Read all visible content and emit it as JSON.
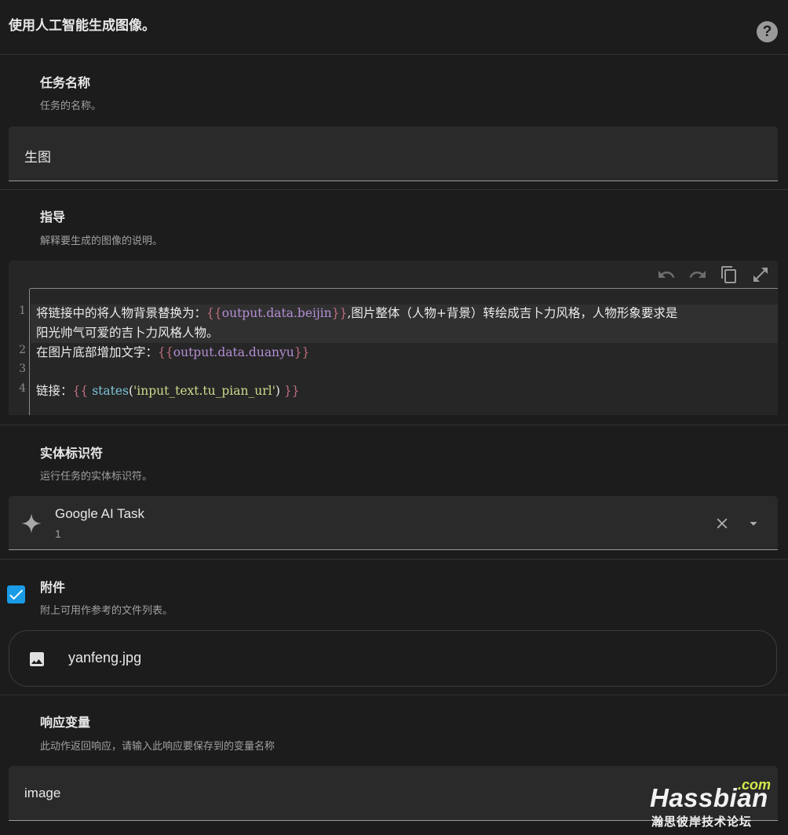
{
  "header": {
    "title": "使用人工智能生成图像。",
    "help_icon": "help-circle-icon"
  },
  "task_name": {
    "label": "任务名称",
    "description": "任务的名称。",
    "value": "生图"
  },
  "instructions": {
    "label": "指导",
    "description": "解释要生成的图像的说明。",
    "toolbar": [
      "undo-icon",
      "redo-icon",
      "copy-icon",
      "fullscreen-icon"
    ],
    "line_numbers": [
      "1",
      "2",
      "3",
      "4"
    ],
    "lines": {
      "l1a_text": "将链接中的将人物背景替换为：",
      "l1a_open": "{{",
      "l1a_var": "output.data.beijin",
      "l1a_close": "}}",
      "l1a_tail": ",图片整体（人物+背景）转绘成吉卜力风格，人物形象要求是",
      "l1b": "阳光帅气可爱的吉卜力风格人物。",
      "l2_text": "在图片底部增加文字：",
      "l2_open": "{{",
      "l2_var": "output.data.duanyu",
      "l2_close": "}}",
      "l4_text": "链接：",
      "l4_open": "{{",
      "l4_fn": "states",
      "l4_paren_open": "(",
      "l4_str": "'input_text.tu_pian_url'",
      "l4_paren_close": ")",
      "l4_close": "}}"
    }
  },
  "entity": {
    "label": "实体标识符",
    "description": "运行任务的实体标识符。",
    "name": "Google AI Task",
    "sub": "1",
    "icon": "sparkle-icon"
  },
  "attachments": {
    "label": "附件",
    "description": "附上可用作参考的文件列表。",
    "checked": true,
    "file_name": "yanfeng.jpg",
    "file_icon": "image-icon"
  },
  "response_variable": {
    "label": "响应变量",
    "description": "此动作返回响应，请输入此响应要保存到的变量名称",
    "value": "image"
  },
  "watermark": {
    "com": ".com",
    "main": "Hassbian",
    "sub": "瀚思彼岸技术论坛"
  },
  "colors": {
    "background": "#1c1c1c",
    "field": "#2a2a2a",
    "checkbox": "#1a9be6",
    "code_brace": "#c26e80",
    "code_var": "#b58fd6",
    "code_keyword": "#7ec4d8",
    "code_string": "#d0d98c"
  }
}
